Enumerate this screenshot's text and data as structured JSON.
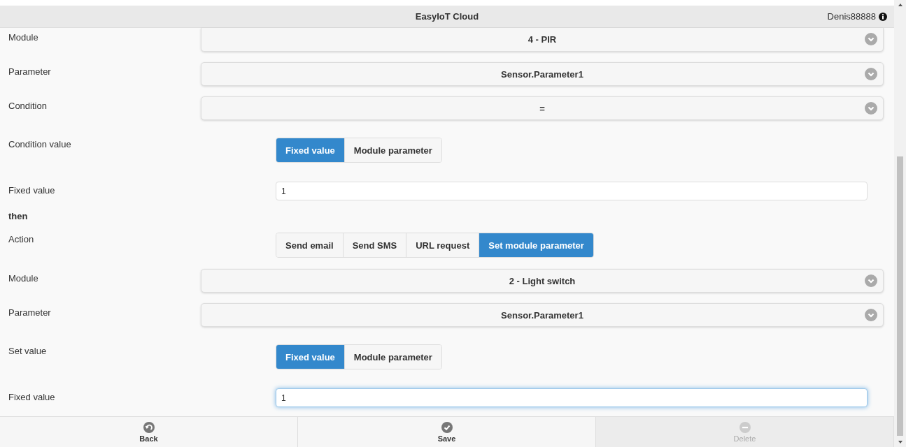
{
  "header": {
    "title": "EasyIoT Cloud",
    "user": "Denis88888"
  },
  "rows": [
    {
      "kind": "select",
      "label": "Module",
      "value": "4 - PIR"
    },
    {
      "kind": "select",
      "label": "Parameter",
      "value": "Sensor.Parameter1"
    },
    {
      "kind": "select",
      "label": "Condition",
      "value": "="
    },
    {
      "kind": "segmented",
      "label": "Condition value",
      "options": [
        {
          "label": "Fixed value",
          "selected": true
        },
        {
          "label": "Module parameter",
          "selected": false
        }
      ]
    },
    {
      "kind": "input",
      "label": "Fixed value",
      "value": "1",
      "focused": false
    },
    {
      "kind": "heading",
      "label": "then"
    },
    {
      "kind": "segmented",
      "label": "Action",
      "options": [
        {
          "label": "Send email",
          "selected": false
        },
        {
          "label": "Send SMS",
          "selected": false
        },
        {
          "label": "URL request",
          "selected": false
        },
        {
          "label": "Set module parameter",
          "selected": true
        }
      ]
    },
    {
      "kind": "select",
      "label": "Module",
      "value": "2 - Light switch"
    },
    {
      "kind": "select",
      "label": "Parameter",
      "value": "Sensor.Parameter1"
    },
    {
      "kind": "segmented",
      "label": "Set value",
      "options": [
        {
          "label": "Fixed value",
          "selected": true
        },
        {
          "label": "Module parameter",
          "selected": false
        }
      ]
    },
    {
      "kind": "input",
      "label": "Fixed value",
      "value": "1",
      "focused": true
    }
  ],
  "footer": [
    {
      "kind": "back",
      "label": "Back",
      "disabled": false
    },
    {
      "kind": "save",
      "label": "Save",
      "disabled": false
    },
    {
      "kind": "delete",
      "label": "Delete",
      "disabled": true
    }
  ]
}
